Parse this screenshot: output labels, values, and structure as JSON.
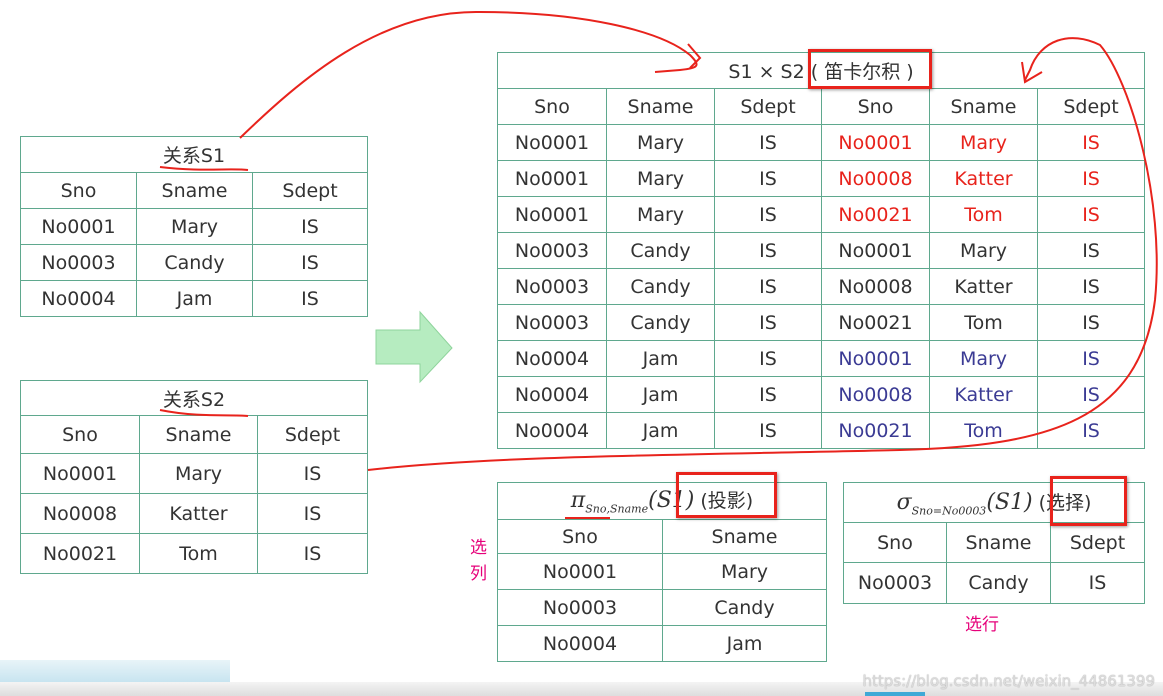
{
  "colors": {
    "border": "#5fa88e",
    "annotation": "#e8231c",
    "highlight_red": "#e8231c",
    "highlight_blue": "#3b3b94",
    "note": "#e6007a"
  },
  "s1": {
    "caption": "关系S1",
    "headers": [
      "Sno",
      "Sname",
      "Sdept"
    ],
    "rows": [
      [
        "No0001",
        "Mary",
        "IS"
      ],
      [
        "No0003",
        "Candy",
        "IS"
      ],
      [
        "No0004",
        "Jam",
        "IS"
      ]
    ]
  },
  "s2": {
    "caption": "关系S2",
    "headers": [
      "Sno",
      "Sname",
      "Sdept"
    ],
    "rows": [
      [
        "No0001",
        "Mary",
        "IS"
      ],
      [
        "No0008",
        "Katter",
        "IS"
      ],
      [
        "No0021",
        "Tom",
        "IS"
      ]
    ]
  },
  "product": {
    "caption": "S1 × S2",
    "caption_note": "( 笛卡尔积 )",
    "headers": [
      "Sno",
      "Sname",
      "Sdept",
      "Sno",
      "Sname",
      "Sdept"
    ],
    "rows": [
      [
        "No0001",
        "Mary",
        "IS",
        "No0001",
        "Mary",
        "IS"
      ],
      [
        "No0001",
        "Mary",
        "IS",
        "No0008",
        "Katter",
        "IS"
      ],
      [
        "No0001",
        "Mary",
        "IS",
        "No0021",
        "Tom",
        "IS"
      ],
      [
        "No0003",
        "Candy",
        "IS",
        "No0001",
        "Mary",
        "IS"
      ],
      [
        "No0003",
        "Candy",
        "IS",
        "No0008",
        "Katter",
        "IS"
      ],
      [
        "No0003",
        "Candy",
        "IS",
        "No0021",
        "Tom",
        "IS"
      ],
      [
        "No0004",
        "Jam",
        "IS",
        "No0001",
        "Mary",
        "IS"
      ],
      [
        "No0004",
        "Jam",
        "IS",
        "No0008",
        "Katter",
        "IS"
      ],
      [
        "No0004",
        "Jam",
        "IS",
        "No0021",
        "Tom",
        "IS"
      ]
    ],
    "highlight": [
      "red",
      "red",
      "red",
      "",
      "",
      "",
      "blue",
      "blue",
      "blue"
    ]
  },
  "projection": {
    "symbol": "π",
    "subscript": "Sno,Sname",
    "arg": "(S1)",
    "caption_note": "(投影)",
    "headers": [
      "Sno",
      "Sname"
    ],
    "rows": [
      [
        "No0001",
        "Mary"
      ],
      [
        "No0003",
        "Candy"
      ],
      [
        "No0004",
        "Jam"
      ]
    ],
    "side_note": "选列"
  },
  "selection": {
    "symbol": "σ",
    "subscript": "Sno=No0003",
    "arg": "(S1)",
    "caption_note": "(选择)",
    "headers": [
      "Sno",
      "Sname",
      "Sdept"
    ],
    "rows": [
      [
        "No0003",
        "Candy",
        "IS"
      ]
    ],
    "bottom_note": "选行"
  },
  "watermark": "https://blog.csdn.net/weixin_44861399"
}
